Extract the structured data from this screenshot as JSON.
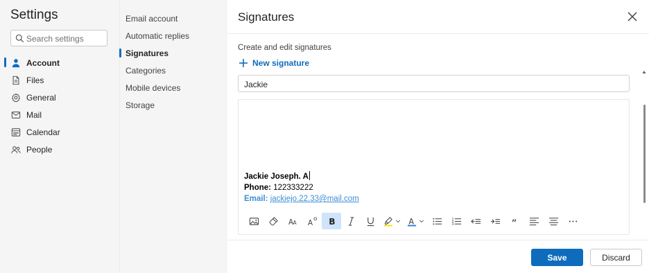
{
  "app": {
    "title": "Settings"
  },
  "search": {
    "placeholder": "Search settings"
  },
  "categories": [
    {
      "label": "Account",
      "icon": "person-icon",
      "active": true
    },
    {
      "label": "Files",
      "icon": "file-icon",
      "active": false
    },
    {
      "label": "General",
      "icon": "gear-icon",
      "active": false
    },
    {
      "label": "Mail",
      "icon": "mail-icon",
      "active": false
    },
    {
      "label": "Calendar",
      "icon": "calendar-icon",
      "active": false
    },
    {
      "label": "People",
      "icon": "people-icon",
      "active": false
    }
  ],
  "subnav": [
    {
      "label": "Email account",
      "active": false
    },
    {
      "label": "Automatic replies",
      "active": false
    },
    {
      "label": "Signatures",
      "active": true
    },
    {
      "label": "Categories",
      "active": false
    },
    {
      "label": "Mobile devices",
      "active": false
    },
    {
      "label": "Storage",
      "active": false
    }
  ],
  "panel": {
    "title": "Signatures",
    "subheading": "Create and edit signatures",
    "new_signature_label": "New signature",
    "signature_name": "Jackie",
    "signature": {
      "name_line": "Jackie Joseph. A",
      "phone_label": "Phone:",
      "phone_value": "122333222",
      "email_label": "Email:",
      "email_value": "jackiejo.22.33@mail.com"
    },
    "toolbar": [
      "insert-picture-icon",
      "format-painter-icon",
      "font-size-icon",
      "superscript-icon",
      "bold-icon",
      "italic-icon",
      "underline-icon",
      "highlight-icon",
      "font-color-icon",
      "bullet-list-icon",
      "numbered-list-icon",
      "decrease-indent-icon",
      "increase-indent-icon",
      "quote-icon",
      "align-left-icon",
      "align-center-icon",
      "more-options-icon"
    ]
  },
  "footer": {
    "save_label": "Save",
    "discard_label": "Discard"
  },
  "colors": {
    "accent": "#0f6cbd",
    "link": "#3b8ed6",
    "highlight_yellow": "#ffe000",
    "font_color_blue": "#2f7ad3",
    "selected_bg": "#cfe4fa"
  }
}
